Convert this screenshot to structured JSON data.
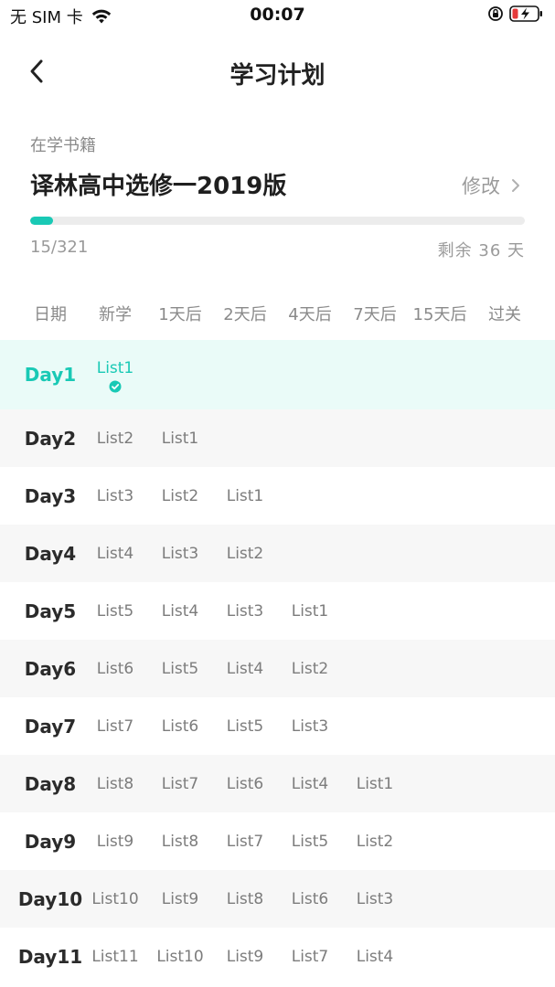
{
  "status_bar": {
    "carrier": "无 SIM 卡",
    "time": "00:07"
  },
  "nav": {
    "title": "学习计划",
    "back_icon": "chevron-left-icon"
  },
  "book": {
    "label": "在学书籍",
    "name": "译林高中选修一2019版",
    "edit_label": "修改",
    "progress_text": "15/321",
    "progress_fraction": 0.0467,
    "remaining_text": "剩余 36 天"
  },
  "accent_color": "#19c9b5",
  "table": {
    "headers": [
      "日期",
      "新学",
      "1天后",
      "2天后",
      "4天后",
      "7天后",
      "15天后",
      "过关"
    ],
    "rows": [
      {
        "day": "Day1",
        "cells": [
          "List1"
        ],
        "completed": true
      },
      {
        "day": "Day2",
        "cells": [
          "List2",
          "List1"
        ]
      },
      {
        "day": "Day3",
        "cells": [
          "List3",
          "List2",
          "List1"
        ]
      },
      {
        "day": "Day4",
        "cells": [
          "List4",
          "List3",
          "List2"
        ]
      },
      {
        "day": "Day5",
        "cells": [
          "List5",
          "List4",
          "List3",
          "List1"
        ]
      },
      {
        "day": "Day6",
        "cells": [
          "List6",
          "List5",
          "List4",
          "List2"
        ]
      },
      {
        "day": "Day7",
        "cells": [
          "List7",
          "List6",
          "List5",
          "List3"
        ]
      },
      {
        "day": "Day8",
        "cells": [
          "List8",
          "List7",
          "List6",
          "List4",
          "List1"
        ]
      },
      {
        "day": "Day9",
        "cells": [
          "List9",
          "List8",
          "List7",
          "List5",
          "List2"
        ]
      },
      {
        "day": "Day10",
        "cells": [
          "List10",
          "List9",
          "List8",
          "List6",
          "List3"
        ]
      },
      {
        "day": "Day11",
        "cells": [
          "List11",
          "List10",
          "List9",
          "List7",
          "List4"
        ]
      }
    ]
  }
}
